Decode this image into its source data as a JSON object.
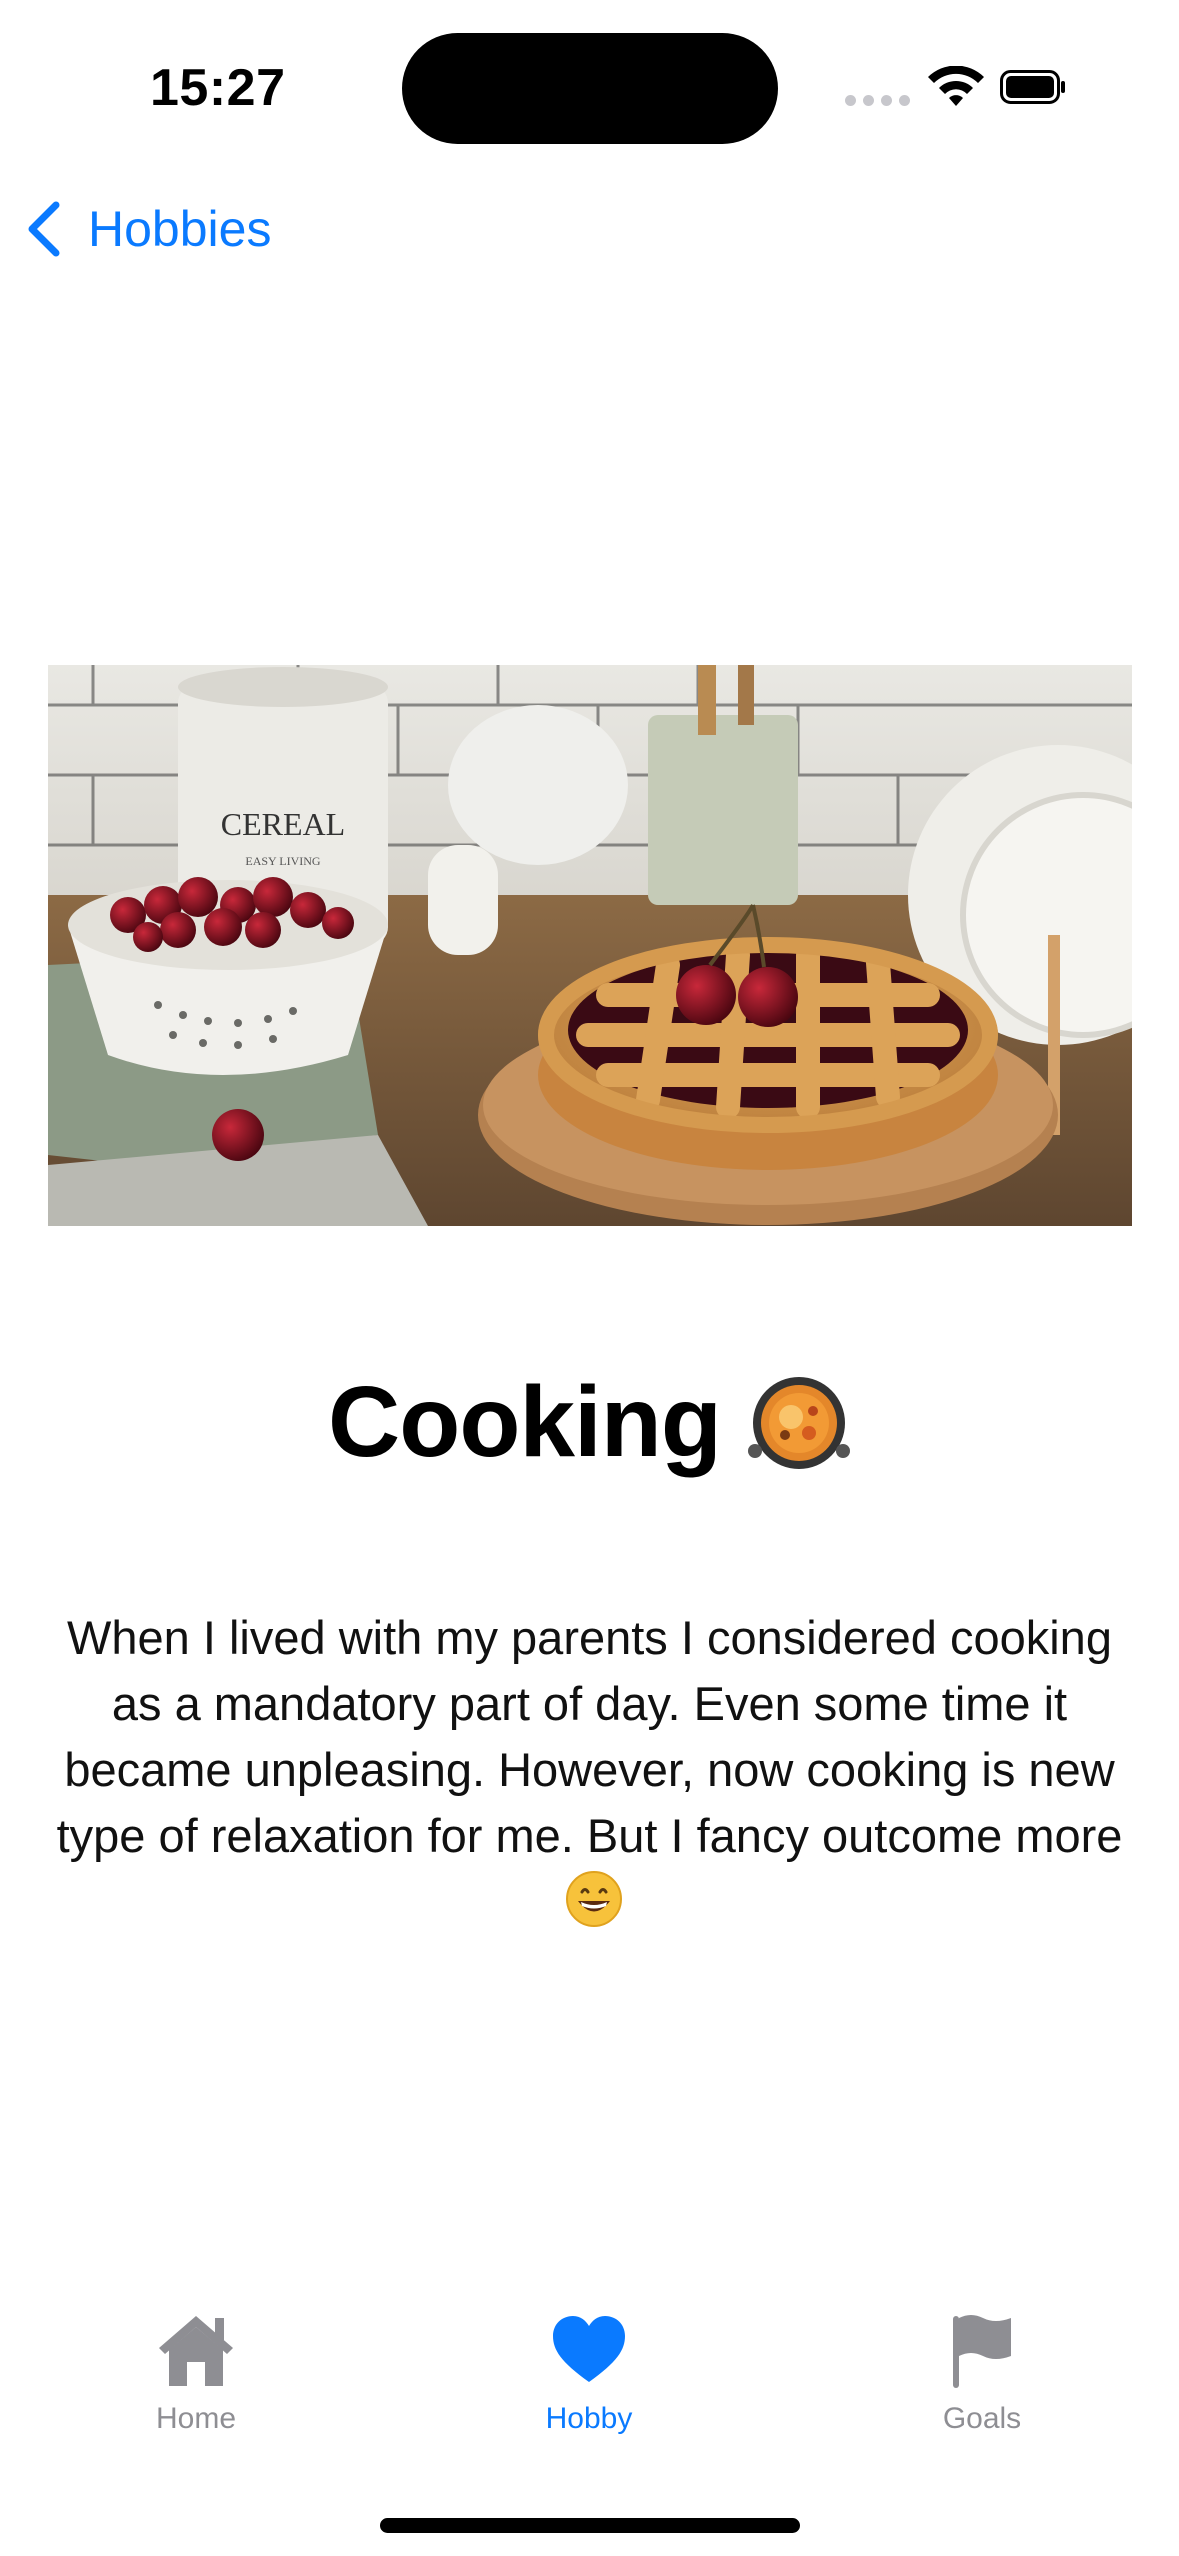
{
  "status_bar": {
    "time": "15:27"
  },
  "nav": {
    "back_label": "Hobbies"
  },
  "hero": {
    "description": "photo of a cherry lattice pie on a wooden board with a colander of cherries and kitchen canisters"
  },
  "hobby": {
    "title": "Cooking",
    "title_emoji": "cooking-pan-icon",
    "body": "When I lived with my parents I considered cooking as a mandatory part of day. Even some time it became unpleasing. However, now cooking is new type of relaxation for me. But I fancy outcome more",
    "body_emoji": "grinning-face-icon"
  },
  "tabbar": {
    "items": [
      {
        "label": "Home",
        "icon": "house-icon",
        "active": false
      },
      {
        "label": "Hobby",
        "icon": "heart-icon",
        "active": true
      },
      {
        "label": "Goals",
        "icon": "flag-icon",
        "active": false
      }
    ]
  },
  "colors": {
    "accent": "#0a7aff",
    "inactive": "#8e8e93"
  }
}
